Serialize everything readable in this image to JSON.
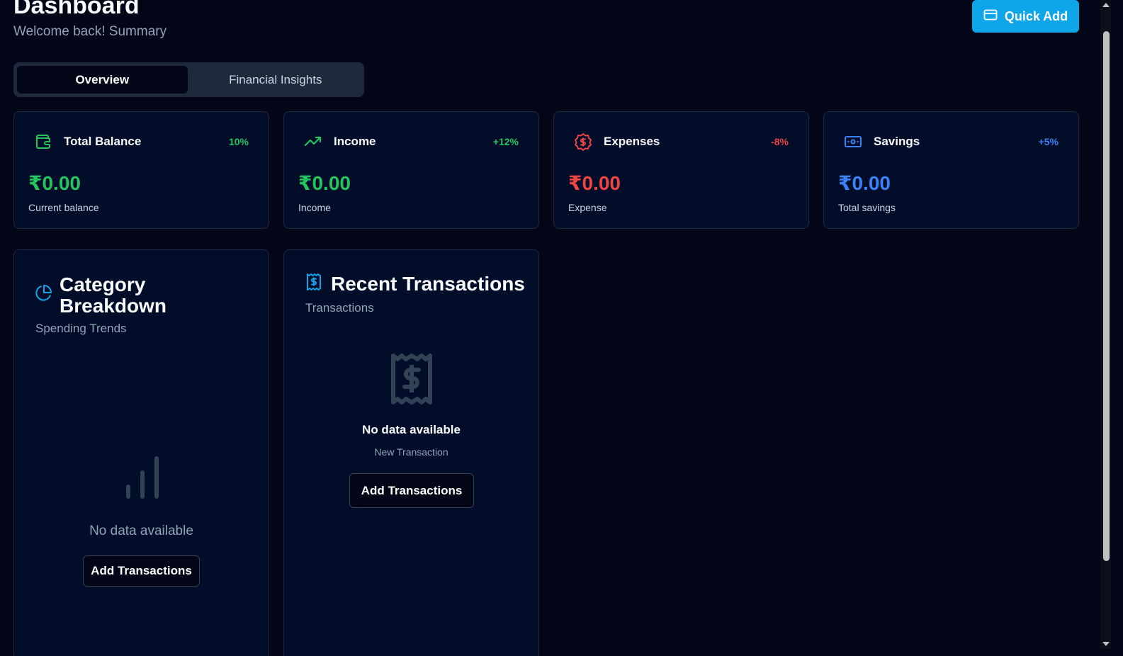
{
  "header": {
    "title": "Dashboard",
    "subtitle": "Welcome back! Summary",
    "quick_add_label": "Quick Add"
  },
  "tabs": [
    {
      "label": "Overview",
      "active": true
    },
    {
      "label": "Financial Insights",
      "active": false
    }
  ],
  "stats": [
    {
      "label": "Total Balance",
      "change": "10%",
      "value": "₹0.00",
      "desc": "Current balance",
      "color": "#22c55e",
      "icon": "wallet-icon"
    },
    {
      "label": "Income",
      "change": "+12%",
      "value": "₹0.00",
      "desc": "Income",
      "color": "#22c55e",
      "icon": "trending-up-icon"
    },
    {
      "label": "Expenses",
      "change": "-8%",
      "value": "₹0.00",
      "desc": "Expense",
      "color": "#ef4444",
      "icon": "dollar-circle-icon"
    },
    {
      "label": "Savings",
      "change": "+5%",
      "value": "₹0.00",
      "desc": "Total savings",
      "color": "#3b82f6",
      "icon": "banknote-icon"
    }
  ],
  "category": {
    "title_line1": "Category",
    "title_line2": "Breakdown",
    "subtitle": "Spending Trends",
    "empty_text": "No data available",
    "button_label": "Add Transactions"
  },
  "recent": {
    "title": "Recent Transactions",
    "subtitle": "Transactions",
    "empty_title": "No data available",
    "empty_sub": "New Transaction",
    "button_label": "Add Transactions"
  },
  "colors": {
    "accent": "#0ea5e9",
    "background": "#020617",
    "card": "#020d2a"
  }
}
